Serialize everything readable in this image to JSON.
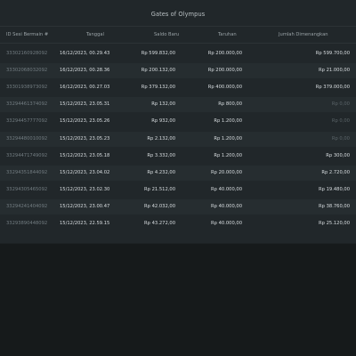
{
  "window": {
    "title": "Gates of Olympus"
  },
  "table": {
    "columns": {
      "id": "ID Sesi Bermain #",
      "date": "Tanggal",
      "balance": "Saldo Baru",
      "bet": "Taruhan",
      "win": "Jumlah Dimenangkan"
    },
    "rows": [
      {
        "id": "33302160928092",
        "date": "16/12/2023, 00.29.43",
        "balance": "Rp 599.832,00",
        "bet": "Rp 200.000,00",
        "win": "Rp 599.700,00"
      },
      {
        "id": "33302068032092",
        "date": "16/12/2023, 00.28.36",
        "balance": "Rp 200.132,00",
        "bet": "Rp 200.000,00",
        "win": "Rp 21.000,00"
      },
      {
        "id": "33301938973092",
        "date": "16/12/2023, 00.27.03",
        "balance": "Rp 379.132,00",
        "bet": "Rp 400.000,00",
        "win": "Rp 379.000,00"
      },
      {
        "id": "33294461374092",
        "date": "15/12/2023, 23.05.31",
        "balance": "Rp 132,00",
        "bet": "Rp 800,00",
        "win": "Rp 0,00"
      },
      {
        "id": "33294457777092",
        "date": "15/12/2023, 23.05.26",
        "balance": "Rp 932,00",
        "bet": "Rp 1.200,00",
        "win": "Rp 0,00"
      },
      {
        "id": "33294480010092",
        "date": "15/12/2023, 23.05.23",
        "balance": "Rp 2.132,00",
        "bet": "Rp 1.200,00",
        "win": "Rp 0,00"
      },
      {
        "id": "33294471749092",
        "date": "15/12/2023, 23.05.18",
        "balance": "Rp 3.332,00",
        "bet": "Rp 1.200,00",
        "win": "Rp 300,00"
      },
      {
        "id": "33294351844092",
        "date": "15/12/2023, 23.04.02",
        "balance": "Rp 4.232,00",
        "bet": "Rp 20.000,00",
        "win": "Rp 2.720,00"
      },
      {
        "id": "33294305465092",
        "date": "15/12/2023, 23.02.30",
        "balance": "Rp 21.512,00",
        "bet": "Rp 40.000,00",
        "win": "Rp 19.480,00"
      },
      {
        "id": "33294241404092",
        "date": "15/12/2023, 23.00.47",
        "balance": "Rp 42.032,00",
        "bet": "Rp 40.000,00",
        "win": "Rp 38.760,00"
      },
      {
        "id": "33293890448092",
        "date": "15/12/2023, 22.59.15",
        "balance": "Rp 43.272,00",
        "bet": "Rp 40.000,00",
        "win": "Rp 25.120,00"
      }
    ]
  },
  "colors": {
    "background": "#161a1b",
    "panel": "#21272a",
    "row_alt": "#262d30",
    "text_primary": "#d8dde0",
    "text_muted": "#727c81",
    "zero_win": "#5b6468"
  }
}
